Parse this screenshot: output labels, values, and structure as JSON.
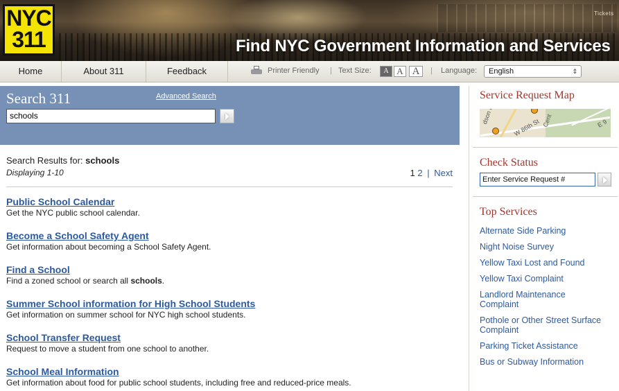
{
  "banner": {
    "logo_line1": "NYC",
    "logo_line2": "311",
    "title": "Find NYC Government Information and Services",
    "sign_text": "Tickets"
  },
  "nav": {
    "home": "Home",
    "about": "About 311",
    "feedback": "Feedback",
    "printer_friendly": "Printer Friendly",
    "text_size_label": "Text Size:",
    "text_size_buttons": [
      "A",
      "A",
      "A"
    ],
    "separator": "|",
    "language_label": "Language:",
    "language_value": "English"
  },
  "search": {
    "title": "Search 311",
    "advanced_link": "Advanced Search",
    "query": "schools"
  },
  "results": {
    "header_label": "Search Results for:",
    "header_query": "schools",
    "displaying": "Displaying 1-10",
    "pager": {
      "current": "1",
      "page2": "2",
      "separator": "|",
      "next": "Next"
    },
    "items": [
      {
        "title": "Public School Calendar",
        "desc": "Get the NYC public school calendar."
      },
      {
        "title": "Become a School Safety Agent",
        "desc": "Get information about becoming a School Safety Agent."
      },
      {
        "title": "Find a School",
        "desc_before": "Find a zoned school or search all ",
        "desc_bold": "schools",
        "desc_after": "."
      },
      {
        "title": "Summer School information for High School Students",
        "desc": "Get information on summer school for NYC high school students."
      },
      {
        "title": "School Transfer Request",
        "desc": "Request to move a student from one school to another."
      },
      {
        "title": "School Meal Information",
        "desc": "Get information about food for public school students, including free and reduced-price meals."
      }
    ]
  },
  "sidebar": {
    "map_title": "Service Request Map",
    "map_labels": [
      "dson P",
      "W 86th St",
      "Cent",
      "E 9"
    ],
    "status_title": "Check Status",
    "status_placeholder": "Enter Service Request #",
    "top_services_title": "Top Services",
    "top_services": [
      "Alternate Side Parking",
      "Night Noise Survey",
      "Yellow Taxi Lost and Found",
      "Yellow Taxi Complaint",
      "Landlord Maintenance Complaint",
      "Pothole or Other Street Surface Complaint",
      "Parking Ticket Assistance",
      "Bus or Subway Information"
    ]
  },
  "colors": {
    "search_panel": "#7690b6",
    "link": "#2c5aa0",
    "sidebar_heading": "#a5332a",
    "logo_yellow": "#f5e400"
  }
}
